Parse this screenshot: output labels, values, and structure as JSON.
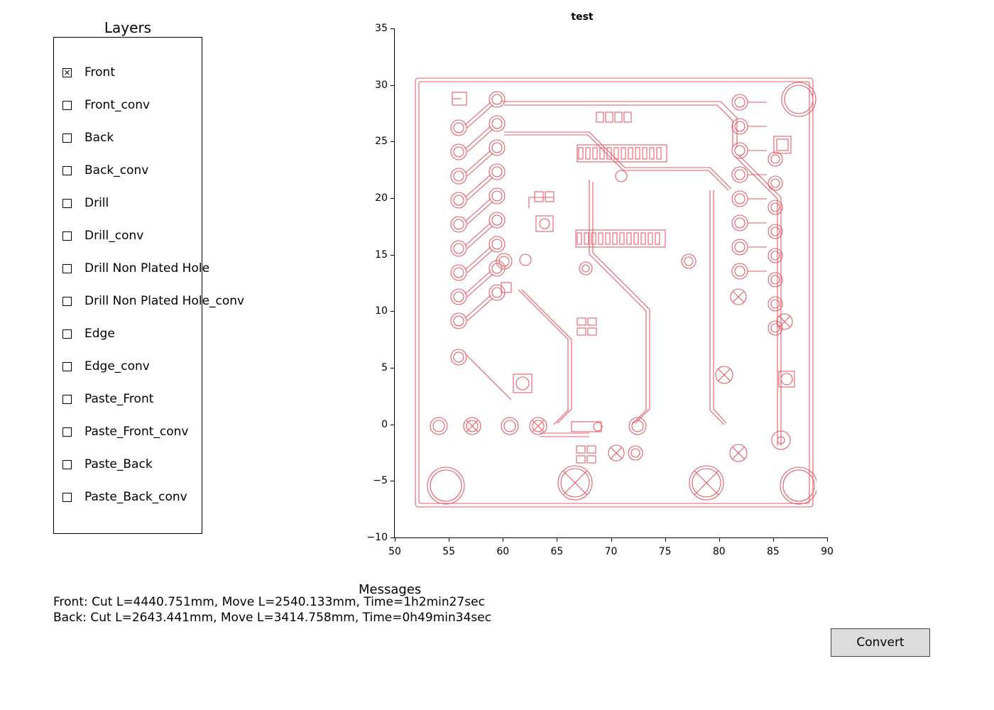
{
  "layers": {
    "title": "Layers",
    "items": [
      {
        "label": "Front",
        "checked": true
      },
      {
        "label": "Front_conv",
        "checked": false
      },
      {
        "label": "Back",
        "checked": false
      },
      {
        "label": "Back_conv",
        "checked": false
      },
      {
        "label": "Drill",
        "checked": false
      },
      {
        "label": "Drill_conv",
        "checked": false
      },
      {
        "label": "Drill Non Plated Hole",
        "checked": false
      },
      {
        "label": "Drill Non Plated Hole_conv",
        "checked": false
      },
      {
        "label": "Edge",
        "checked": false
      },
      {
        "label": "Edge_conv",
        "checked": false
      },
      {
        "label": "Paste_Front",
        "checked": false
      },
      {
        "label": "Paste_Front_conv",
        "checked": false
      },
      {
        "label": "Paste_Back",
        "checked": false
      },
      {
        "label": "Paste_Back_conv",
        "checked": false
      }
    ]
  },
  "chart_data": {
    "type": "pcb_layer",
    "title": "test",
    "xlim": [
      50,
      90
    ],
    "ylim": [
      -10,
      35
    ],
    "x_ticks": [
      50,
      55,
      60,
      65,
      70,
      75,
      80,
      85,
      90
    ],
    "y_ticks": [
      -10,
      -5,
      0,
      5,
      10,
      15,
      20,
      25,
      30,
      35
    ],
    "stroke_color": "#e75b67"
  },
  "messages": {
    "title": "Messages",
    "lines": [
      "Front: Cut L=4440.751mm, Move L=2540.133mm, Time=1h2min27sec",
      "Back: Cut L=2643.441mm, Move L=3414.758mm, Time=0h49min34sec"
    ]
  },
  "buttons": {
    "convert_label": "Convert"
  }
}
